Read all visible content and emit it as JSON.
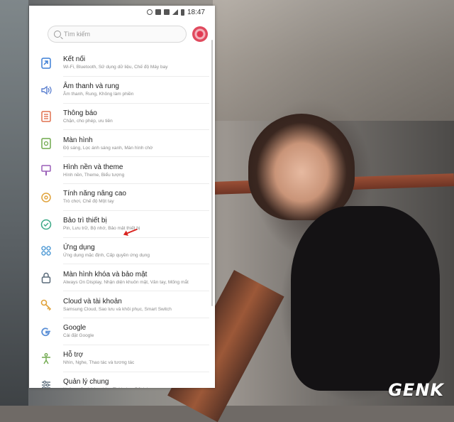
{
  "status_bar": {
    "time": "18:47"
  },
  "search": {
    "placeholder": "Tìm kiếm"
  },
  "settings": [
    {
      "id": "ket-noi",
      "icon": "connections-icon",
      "color": "#3d7fd6",
      "title": "Kết nối",
      "subtitle": "Wi-Fi, Bluetooth, Sử dụng dữ liệu, Chế độ Máy bay"
    },
    {
      "id": "am-thanh",
      "icon": "sound-icon",
      "color": "#5a7fcf",
      "title": "Âm thanh và rung",
      "subtitle": "Âm thanh, Rung, Không làm phiền"
    },
    {
      "id": "thong-bao",
      "icon": "notifications-icon",
      "color": "#e0704f",
      "title": "Thông báo",
      "subtitle": "Chặn, cho phép, ưu tiên"
    },
    {
      "id": "man-hinh",
      "icon": "display-icon",
      "color": "#6fa84c",
      "title": "Màn hình",
      "subtitle": "Độ sáng, Lọc ánh sáng xanh, Màn hình chờ"
    },
    {
      "id": "hinh-nen",
      "icon": "wallpaper-icon",
      "color": "#9a5fb8",
      "title": "Hình nền và theme",
      "subtitle": "Hình nền, Theme, Biểu tượng"
    },
    {
      "id": "tinh-nang",
      "icon": "advanced-features-icon",
      "color": "#e0a23a",
      "title": "Tính năng nâng cao",
      "subtitle": "Trò chơi, Chế độ Một tay"
    },
    {
      "id": "bao-tri",
      "icon": "device-maintenance-icon",
      "color": "#3aa885",
      "title": "Bảo trì thiết bị",
      "subtitle": "Pin, Lưu trữ, Bộ nhớ, Bảo mật thiết bị"
    },
    {
      "id": "ung-dung",
      "icon": "apps-icon",
      "color": "#3c8fd0",
      "title": "Ứng dụng",
      "subtitle": "Ứng dụng mặc định, Cấp quyền ứng dụng"
    },
    {
      "id": "man-hinh-khoa",
      "icon": "lock-screen-icon",
      "color": "#5a6b7a",
      "title": "Màn hình khóa và bảo mật",
      "subtitle": "Always On Display, Nhận diện khuôn mặt, Vân tay, Mống mắt"
    },
    {
      "id": "cloud",
      "icon": "cloud-accounts-icon",
      "color": "#e0a23a",
      "title": "Cloud và tài khoản",
      "subtitle": "Samsung Cloud, Sao lưu và khôi phục, Smart Switch"
    },
    {
      "id": "google",
      "icon": "google-icon",
      "color": "#5a8fd6",
      "title": "Google",
      "subtitle": "Cài đặt Google"
    },
    {
      "id": "ho-tro",
      "icon": "accessibility-icon",
      "color": "#6fa84c",
      "title": "Hỗ trợ",
      "subtitle": "Nhìn, Nghe, Thao tác và tương tác"
    },
    {
      "id": "quan-ly-chung",
      "icon": "general-management-icon",
      "color": "#5a6b7a",
      "title": "Quản lý chung",
      "subtitle": "Ngôn ngữ và bàn phím, Thời gian, Đặt lại"
    }
  ],
  "watermark": "GENK"
}
